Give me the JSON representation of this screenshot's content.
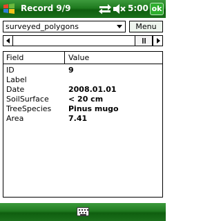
{
  "title_bar": {
    "title": "Record 9/9",
    "time": "5:00",
    "ok_label": "ok",
    "icons": [
      "windows-start-icon",
      "connectivity-icon",
      "volume-muted-icon"
    ]
  },
  "toolbar": {
    "layer_select": "surveyed_polygons",
    "menu_label": "Menu"
  },
  "list": {
    "headers": {
      "field": "Field",
      "value": "Value"
    },
    "rows": [
      {
        "field": "ID",
        "value": "9"
      },
      {
        "field": "Label",
        "value": ""
      },
      {
        "field": "Date",
        "value": "2008.01.01"
      },
      {
        "field": "SoilSurface",
        "value": "< 20 cm"
      },
      {
        "field": "TreeSpecies",
        "value": "Pinus mugo"
      },
      {
        "field": "Area",
        "value": "7.41"
      }
    ]
  },
  "bottom_bar": {
    "icon": "keyboard-icon"
  },
  "colors": {
    "bar_green": "#1f7a1f",
    "ok_green": "#2fae2f"
  }
}
